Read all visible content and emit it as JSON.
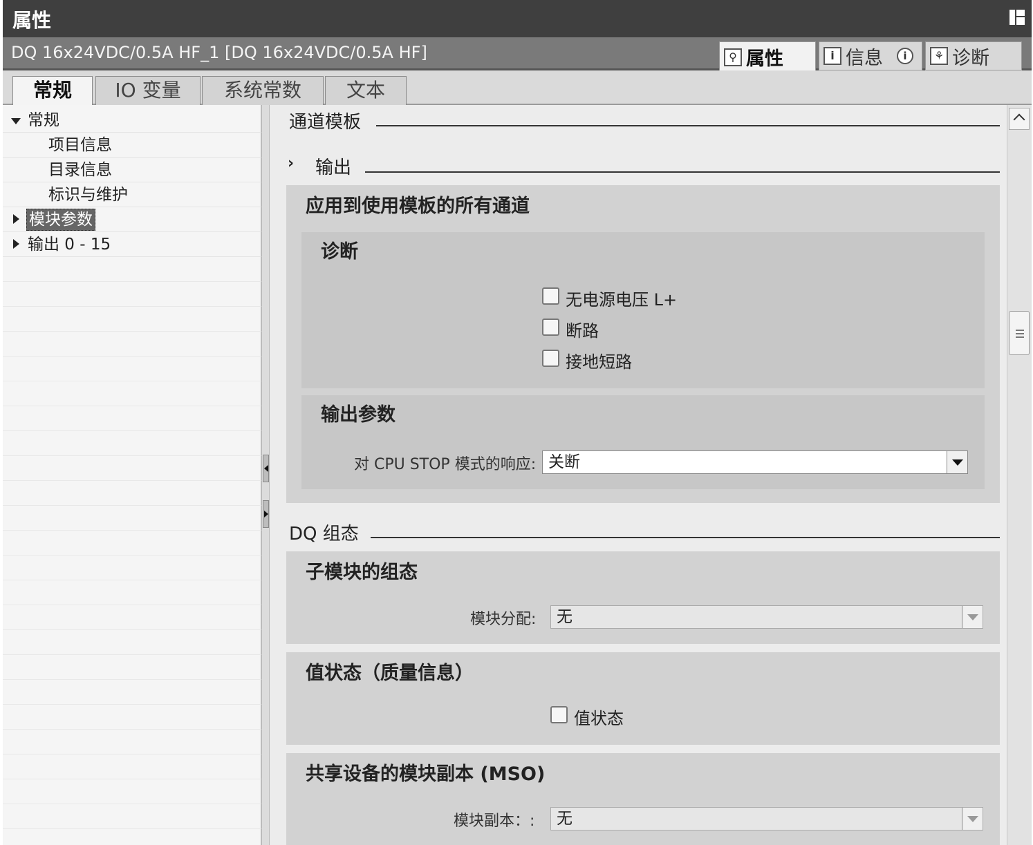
{
  "window": {
    "title": "属性"
  },
  "object": {
    "title": "DQ 16x24VDC/0.5A HF_1 [DQ 16x24VDC/0.5A HF]"
  },
  "inspector_tabs": [
    {
      "label": "属性",
      "icon": "magnifier-icon",
      "active": true
    },
    {
      "label": "信息",
      "icon": "info-arrow-icon",
      "active": false
    },
    {
      "label": "诊断",
      "icon": "diagnostics-icon",
      "active": false
    }
  ],
  "tabs": [
    {
      "label": "常规",
      "active": true
    },
    {
      "label": "IO 变量",
      "active": false
    },
    {
      "label": "系统常数",
      "active": false
    },
    {
      "label": "文本",
      "active": false
    }
  ],
  "tree": {
    "items": [
      {
        "label": "常规",
        "expanded": true
      },
      {
        "label": "项目信息"
      },
      {
        "label": "目录信息"
      },
      {
        "label": "标识与维护"
      },
      {
        "label": "模块参数",
        "selected": true
      },
      {
        "label": "输出 0 - 15"
      }
    ]
  },
  "main": {
    "section_channel_template": "通道模板",
    "output_header": "输出",
    "apply_all_title": "应用到使用模板的所有通道",
    "diagnostics": {
      "title": "诊断",
      "checkboxes": [
        {
          "label": "无电源电压 L+",
          "checked": false
        },
        {
          "label": "断路",
          "checked": false
        },
        {
          "label": "接地短路",
          "checked": false
        }
      ]
    },
    "output_params": {
      "title": "输出参数",
      "label": "对 CPU STOP 模式的响应:",
      "value": "关断"
    },
    "section_dq_config": "DQ 组态",
    "submodule": {
      "title": "子模块的组态",
      "label": "模块分配:",
      "value": "无"
    },
    "value_status": {
      "title": "值状态（质量信息）",
      "checkbox_label": "值状态",
      "checked": false
    },
    "mso": {
      "title": "共享设备的模块副本 (MSO)",
      "label": "模块副本：:",
      "value": "无"
    }
  },
  "colors": {
    "titlebar": "#3f3f3f",
    "subbar": "#7a7a7a",
    "panel": "#d2d2d2"
  }
}
